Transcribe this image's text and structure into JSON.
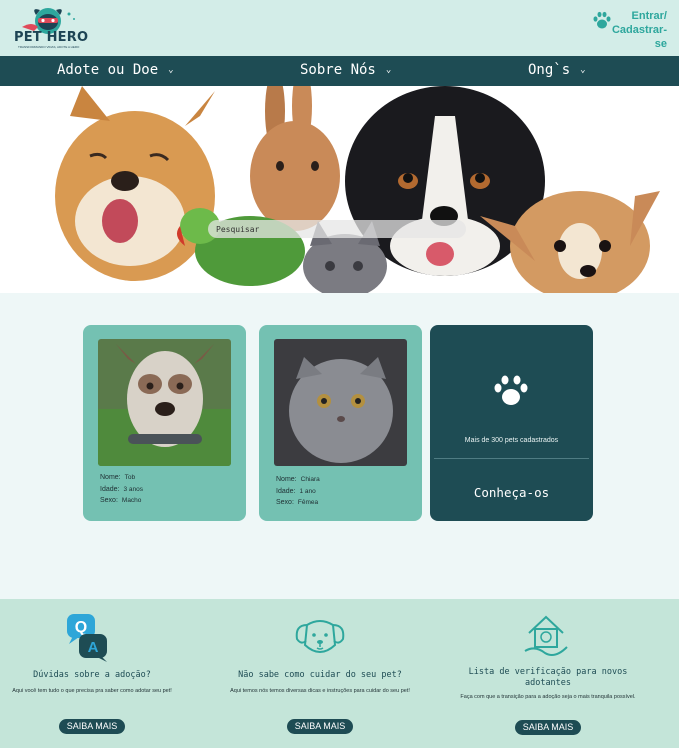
{
  "header": {
    "logo_text": "PET HERO",
    "logo_tagline": "TRANSFORMANDO VIDAS, ADOTE A HERO",
    "login_label_1": "Entrar/",
    "login_label_2": "Cadastrar-se"
  },
  "nav": {
    "items": [
      {
        "label": "Adote ou Doe",
        "icon": "chevron-down-icon"
      },
      {
        "label": "Sobre Nós",
        "icon": "chevron-down-icon"
      },
      {
        "label": "Ong`s",
        "icon": "chevron-down-icon"
      }
    ]
  },
  "hero": {
    "search_placeholder": "Pesquisar"
  },
  "pets": [
    {
      "name_label": "Nome:",
      "name": "Tob",
      "age_label": "Idade:",
      "age": "3 anos",
      "sex_label": "Sexo:",
      "sex": "Macho"
    },
    {
      "name_label": "Nome:",
      "name": "Chiara",
      "age_label": "Idade:",
      "age": "1 ano",
      "sex_label": "Sexo:",
      "sex": "Fêmea"
    }
  ],
  "know_card": {
    "count_text": "Mais de 300 pets cadastrados",
    "link_label": "Conheça-os"
  },
  "info": [
    {
      "title": "Dúvidas sobre a adoção?",
      "text": "Aqui você tem tudo o que precisa pra saber como adotar seu pet!",
      "button": "SAIBA MAIS",
      "icon": "qa-icon"
    },
    {
      "title": "Não sabe como cuidar do seu pet?",
      "text": "Aqui temos nós temos diversas dicas e instruções para cuidar do seu pet!",
      "button": "SAIBA MAIS",
      "icon": "dog-face-icon"
    },
    {
      "title": "Lista de verificação para novos adotantes",
      "text": "Faça com que a transição para a adoção seja o mais tranquila possível.",
      "button": "SAIBA MAIS",
      "icon": "pet-house-icon"
    }
  ],
  "colors": {
    "header_bg": "#d3ede8",
    "nav_bg": "#1e4c54",
    "accent": "#2ea79d",
    "card_bg": "#74c1b2",
    "info_bg": "#c4e5d9"
  }
}
